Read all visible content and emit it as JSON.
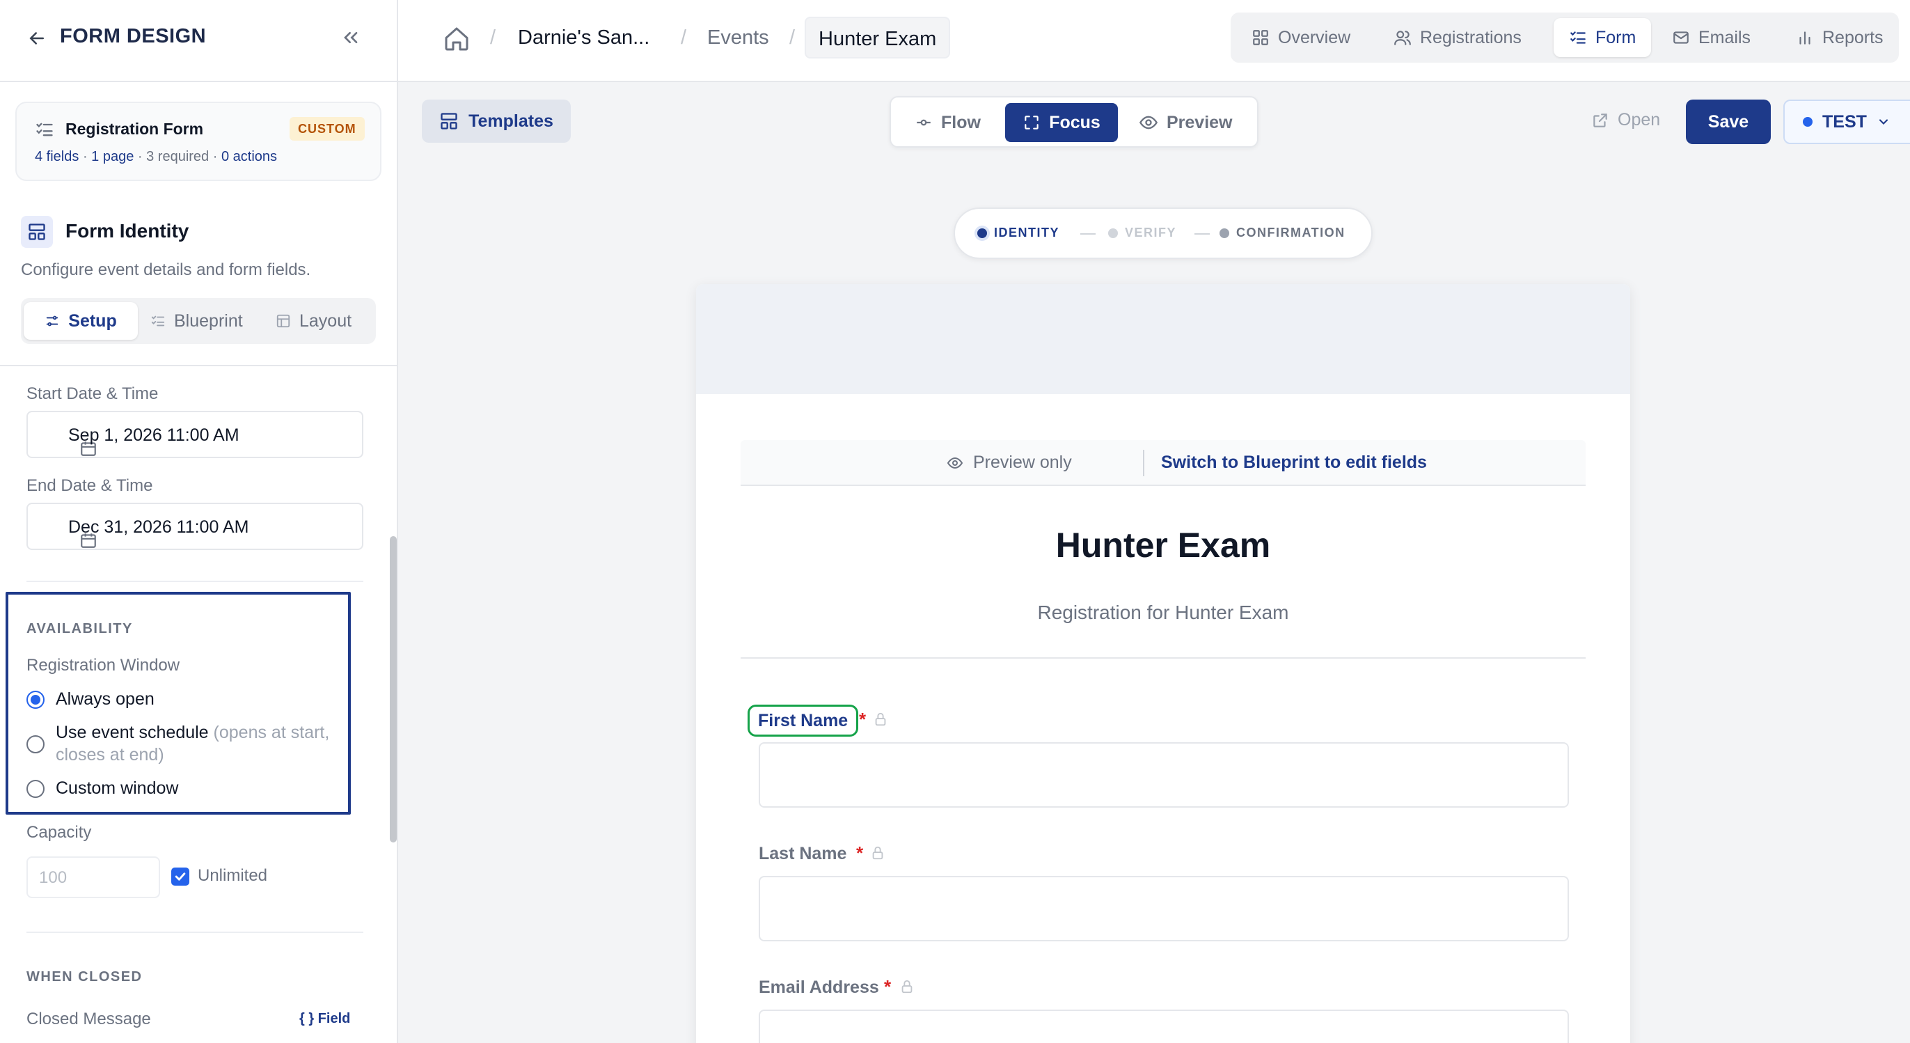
{
  "sidebar": {
    "title": "FORM DESIGN",
    "form_card": {
      "name": "Registration Form",
      "badge": "CUSTOM",
      "fields": "4 fields",
      "pages": "1 page",
      "required": "· 3 required ·",
      "actions": "0 actions"
    },
    "section": {
      "title": "Form Identity",
      "description": "Configure event details and form fields."
    },
    "tabs": [
      {
        "label": "Setup",
        "icon": "sliders-icon",
        "active": true
      },
      {
        "label": "Blueprint",
        "icon": "list-checks-icon",
        "active": false
      },
      {
        "label": "Layout",
        "icon": "layout-icon",
        "active": false
      }
    ],
    "start": {
      "label": "Start Date & Time",
      "value": "Sep 1, 2026 11:00 AM"
    },
    "end": {
      "label": "End Date & Time",
      "value": "Dec 31, 2026 11:00 AM"
    },
    "availability": {
      "heading": "AVAILABILITY",
      "window_label": "Registration Window",
      "options": [
        {
          "label": "Always open",
          "hint": "",
          "selected": true
        },
        {
          "label": "Use event schedule",
          "hint": "(opens at start, closes at end)",
          "selected": false
        },
        {
          "label": "Custom window",
          "hint": "",
          "selected": false
        }
      ]
    },
    "capacity": {
      "label": "Capacity",
      "placeholder": "100",
      "unlimited_label": "Unlimited",
      "unlimited": true
    },
    "when_closed": {
      "heading": "WHEN CLOSED",
      "message_label": "Closed Message",
      "field_tag": "{ } Field"
    }
  },
  "topbar": {
    "breadcrumb": [
      "Darnie's San...",
      "Events",
      "Hunter Exam"
    ],
    "tabs": [
      {
        "label": "Overview",
        "icon": "grid-icon",
        "active": false
      },
      {
        "label": "Registrations",
        "icon": "users-icon",
        "active": false
      },
      {
        "label": "Form",
        "icon": "list-checks-icon",
        "active": true
      },
      {
        "label": "Emails",
        "icon": "mail-icon",
        "active": false
      },
      {
        "label": "Reports",
        "icon": "bar-chart-icon",
        "active": false
      }
    ]
  },
  "toolbar": {
    "templates": "Templates",
    "modes": [
      {
        "label": "Flow",
        "active": false
      },
      {
        "label": "Focus",
        "active": true
      },
      {
        "label": "Preview",
        "active": false
      }
    ],
    "open": "Open",
    "save": "Save",
    "env": "TEST"
  },
  "stepper": [
    "IDENTITY",
    "VERIFY",
    "CONFIRMATION"
  ],
  "form": {
    "preview_only": "Preview only",
    "switch_link": "Switch to Blueprint to edit fields",
    "title": "Hunter Exam",
    "subtitle": "Registration for Hunter Exam",
    "fields": [
      {
        "label": "First Name",
        "required": "*"
      },
      {
        "label": "Last Name",
        "required": "*"
      },
      {
        "label": "Email Address",
        "required": "*"
      }
    ]
  },
  "colors": {
    "primary": "#1e3a8a",
    "accent": "#2563eb",
    "required": "#dc2626",
    "focus_outline": "#16a34a",
    "badge_bg": "#fdf1d3"
  }
}
